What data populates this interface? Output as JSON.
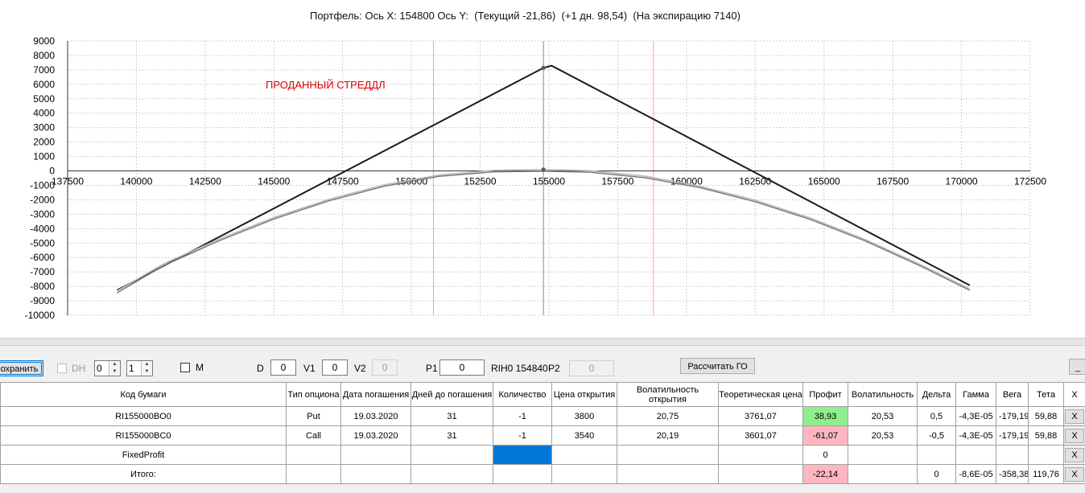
{
  "header": {
    "title": "Портфель: Ось X: 154800 Ось Y:  (Текущий -21,86)  (+1 дн. 98,54)  (На экспирацию 7140)"
  },
  "chart_data": {
    "type": "line",
    "title": "Портфель: Ось X: 154800 Ось Y:  (Текущий -21,86)  (+1 дн. 98,54)  (На экспирацию 7140)",
    "annotation": "ПРОДАННЫЙ СТРЕДДЛ",
    "xlim": [
      137500,
      172500
    ],
    "ylim": [
      -10000,
      9000
    ],
    "x_ticks": [
      137500,
      140000,
      142500,
      145000,
      147500,
      150000,
      152500,
      155000,
      157500,
      160000,
      162500,
      165000,
      167500,
      170000,
      172500
    ],
    "y_ticks": [
      9000,
      8000,
      7000,
      6000,
      5000,
      4000,
      3000,
      2000,
      1000,
      0,
      -1000,
      -2000,
      -3000,
      -4000,
      -5000,
      -6000,
      -7000,
      -8000,
      -9000,
      -10000
    ],
    "grid": true,
    "vertical_lines": [
      {
        "x": 150800,
        "color": "#ff9aa6"
      },
      {
        "x": 154800,
        "color": "#7a8aa8"
      },
      {
        "x": 158800,
        "color": "#ff9aa6"
      }
    ],
    "series": [
      {
        "color": "#1a1a1a",
        "points": [
          [
            139300,
            -8260
          ],
          [
            154800,
            7140
          ],
          [
            155100,
            7290
          ],
          [
            170300,
            -7920
          ]
        ]
      },
      {
        "color": "#7a7a7a",
        "points": [
          [
            139300,
            -8440
          ],
          [
            141000,
            -6550
          ],
          [
            143000,
            -4840
          ],
          [
            145000,
            -3330
          ],
          [
            147000,
            -2070
          ],
          [
            149000,
            -1060
          ],
          [
            151000,
            -380
          ],
          [
            153000,
            -60
          ],
          [
            154800,
            -22
          ],
          [
            156500,
            -90
          ],
          [
            158500,
            -470
          ],
          [
            160500,
            -1160
          ],
          [
            162500,
            -2130
          ],
          [
            164500,
            -3360
          ],
          [
            166500,
            -4850
          ],
          [
            168500,
            -6580
          ],
          [
            170300,
            -8270
          ]
        ]
      },
      {
        "color": "#b8b8b8",
        "points": [
          [
            139300,
            -8310
          ],
          [
            141000,
            -6430
          ],
          [
            143000,
            -4730
          ],
          [
            145000,
            -3230
          ],
          [
            147000,
            -1970
          ],
          [
            149000,
            -960
          ],
          [
            151000,
            -280
          ],
          [
            153000,
            40
          ],
          [
            154800,
            99
          ],
          [
            156500,
            20
          ],
          [
            158500,
            -360
          ],
          [
            160500,
            -1060
          ],
          [
            162500,
            -2030
          ],
          [
            164500,
            -3260
          ],
          [
            166500,
            -4750
          ],
          [
            168500,
            -6480
          ],
          [
            170300,
            -8170
          ]
        ]
      }
    ],
    "markers": [
      [
        154800,
        7140
      ],
      [
        154800,
        99
      ]
    ]
  },
  "toolbar": {
    "save_label": "Сохранить",
    "dh_label": "DH",
    "spin1_value": "0",
    "spin2_value": "1",
    "m_label": "M",
    "d_label": "D",
    "d_value": "0",
    "v1_label": "V1",
    "v1_value": "0",
    "v2_label": "V2",
    "v2_value": "0",
    "p1_label": "P1",
    "p1_value": "0",
    "ticker_text": "RIH0 154840",
    "p2_label": "P2",
    "p2_value": "0",
    "calc_label": "Рассчитать ГО",
    "minimize_label": "_"
  },
  "table": {
    "headers": [
      "Код бумаги",
      "Тип опциона",
      "Дата погашения",
      "Дней до погашения",
      "Количество",
      "Цена открытия",
      "Волатильность открытия",
      "Теоретическая цена",
      "Профит",
      "Волатильность",
      "Дельта",
      "Гамма",
      "Вега",
      "Тета",
      "X"
    ],
    "rows": [
      [
        "RI155000BO0",
        "Put",
        "19.03.2020",
        "31",
        "-1",
        "3800",
        "20,75",
        "3761,07",
        "38,93",
        "20,53",
        "0,5",
        "-4,3E-05",
        "-179,19",
        "59,88",
        "X"
      ],
      [
        "RI155000BC0",
        "Call",
        "19.03.2020",
        "31",
        "-1",
        "3540",
        "20,19",
        "3601,07",
        "-61,07",
        "20,53",
        "-0,5",
        "-4,3E-05",
        "-179,19",
        "59,88",
        "X"
      ],
      [
        "FixedProfit",
        "",
        "",
        "",
        "",
        "",
        "",
        "",
        "0",
        "",
        "",
        "",
        "",
        "",
        "X"
      ],
      [
        "Итого:",
        "",
        "",
        "",
        "",
        "",
        "",
        "",
        "-22,14",
        "",
        "0",
        "-8,6E-05",
        "-358,38",
        "119,76",
        "X"
      ]
    ],
    "cell_colors": {
      "0-8": "pos",
      "1-8": "neg",
      "2-4": "sel",
      "3-8": "neg"
    }
  }
}
